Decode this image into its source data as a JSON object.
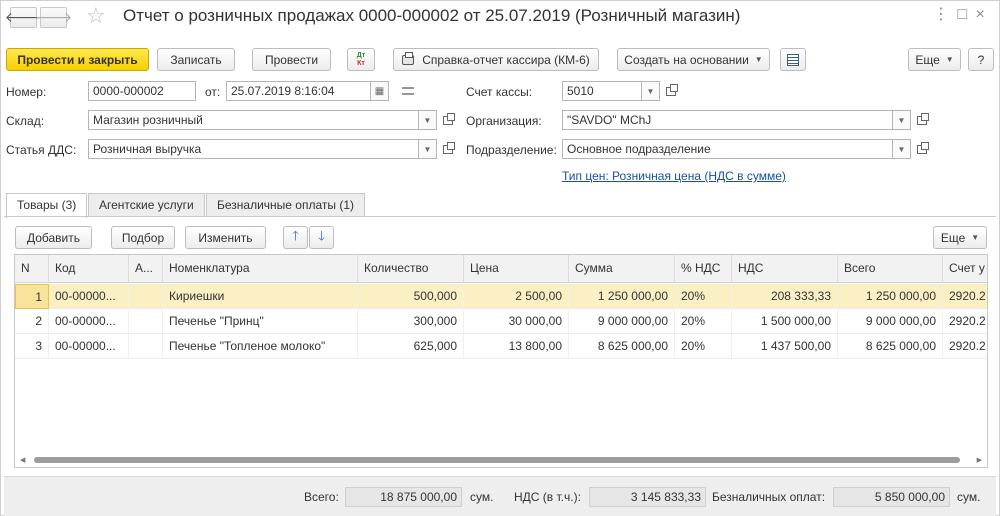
{
  "window": {
    "title": "Отчет о розничных продажах 0000-000002 от 25.07.2019 (Розничный магазин)",
    "controls": "⋮ □ ×"
  },
  "toolbar": {
    "post_close": "Провести и закрыть",
    "save": "Записать",
    "post": "Провести",
    "dtkt": "Дт Кт",
    "print_report": "Справка-отчет кассира (КМ-6)",
    "create_based": "Создать на основании",
    "more": "Еще",
    "help": "?"
  },
  "form": {
    "number_label": "Номер:",
    "number_value": "0000-000002",
    "from_label": "от:",
    "date_value": "25.07.2019  8:16:04",
    "cash_account_label": "Счет кассы:",
    "cash_account_value": "5010",
    "warehouse_label": "Склад:",
    "warehouse_value": "Магазин розничный",
    "org_label": "Организация:",
    "org_value": "\"SAVDO\" MChJ",
    "dds_label": "Статья ДДС:",
    "dds_value": "Розничная выручка",
    "division_label": "Подразделение:",
    "division_value": "Основное подразделение",
    "price_type_link": "Тип цен: Розничная цена (НДС в сумме)"
  },
  "tabs": [
    {
      "label": "Товары (3)"
    },
    {
      "label": "Агентские услуги"
    },
    {
      "label": "Безналичные оплаты (1)"
    }
  ],
  "table_toolbar": {
    "add": "Добавить",
    "select": "Подбор",
    "change": "Изменить",
    "more": "Еще"
  },
  "table": {
    "columns": [
      "N",
      "Код",
      "А...",
      "Номенклатура",
      "Количество",
      "Цена",
      "Сумма",
      "% НДС",
      "НДС",
      "Всего",
      "Счет у"
    ],
    "rows": [
      {
        "n": "1",
        "code": "00-00000...",
        "a": "",
        "item": "Кириешки",
        "qty": "500,000",
        "price": "2 500,00",
        "sum": "1 250 000,00",
        "vat_rate": "20%",
        "vat": "208 333,33",
        "total": "1 250 000,00",
        "account": "2920.2"
      },
      {
        "n": "2",
        "code": "00-00000...",
        "a": "",
        "item": "Печенье \"Принц\"",
        "qty": "300,000",
        "price": "30 000,00",
        "sum": "9 000 000,00",
        "vat_rate": "20%",
        "vat": "1 500 000,00",
        "total": "9 000 000,00",
        "account": "2920.2"
      },
      {
        "n": "3",
        "code": "00-00000...",
        "a": "",
        "item": "Печенье \"Топленое молоко\"",
        "qty": "625,000",
        "price": "13 800,00",
        "sum": "8 625 000,00",
        "vat_rate": "20%",
        "vat": "1 437 500,00",
        "total": "8 625 000,00",
        "account": "2920.2"
      }
    ]
  },
  "footer": {
    "total_label": "Всего:",
    "total_value": "18 875 000,00",
    "total_unit": "сум.",
    "vat_label": "НДС (в т.ч.):",
    "vat_value": "3 145 833,33",
    "cashless_label": "Безналичных оплат:",
    "cashless_value": "5 850 000,00",
    "cashless_unit": "сум."
  },
  "colors": {
    "primary_button": "#f7d000",
    "selected_row": "#fbefc4",
    "link": "#1a4fa0"
  }
}
